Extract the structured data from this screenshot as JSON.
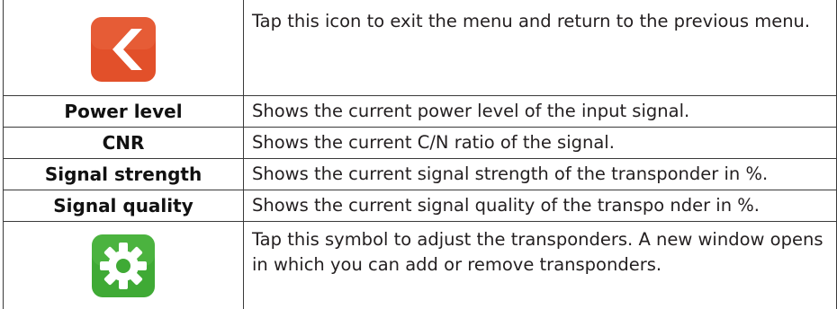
{
  "rows": [
    {
      "term": "",
      "icon": "back-arrow-icon",
      "icon_color": "#e2502a",
      "description": "Tap this icon to exit the menu and return to the previous menu."
    },
    {
      "term": "Power level",
      "description": "Shows the current power level of the input signal."
    },
    {
      "term": "CNR",
      "description": "Shows the current C/N ratio of the signal."
    },
    {
      "term": "Signal strength",
      "description": "Shows the current signal strength of the transponder in %."
    },
    {
      "term": "Signal quality",
      "description": "Shows the current signal quality of the transpo nder in %."
    },
    {
      "term": "",
      "icon": "gear-icon",
      "icon_color": "#3faa35",
      "description": "Tap this symbol to adjust the transponders. A new window opens in which you can add or remove transponders."
    }
  ]
}
